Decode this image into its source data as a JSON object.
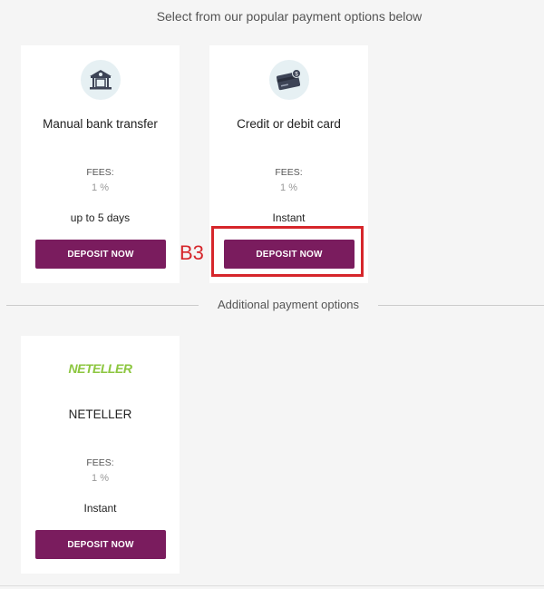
{
  "header": {
    "title": "Select from our popular payment options below"
  },
  "popular_options": [
    {
      "title": "Manual bank transfer",
      "fees_label": "FEES:",
      "fees_value": "1 %",
      "time": "up to 5 days",
      "button": "DEPOSIT NOW",
      "icon": "bank-icon"
    },
    {
      "title": "Credit or debit card",
      "fees_label": "FEES:",
      "fees_value": "1 %",
      "time": "Instant",
      "button": "DEPOSIT NOW",
      "icon": "credit-card-icon"
    }
  ],
  "divider": {
    "label": "Additional payment options"
  },
  "additional_options": [
    {
      "title": "NETELLER",
      "logo_text": "NETELLER",
      "fees_label": "FEES:",
      "fees_value": "1 %",
      "time": "Instant",
      "button": "DEPOSIT NOW"
    }
  ],
  "annotation": {
    "marker": "B3"
  },
  "colors": {
    "button": "#7a1c5e",
    "logo": "#8cc63f",
    "highlight": "#d6262b",
    "icon_bg": "#e6f0f3"
  }
}
